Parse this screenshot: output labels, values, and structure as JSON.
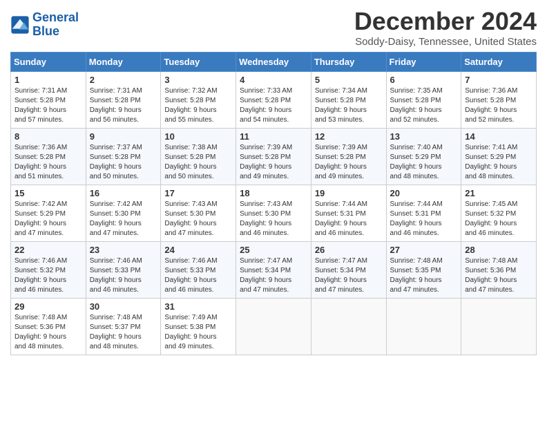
{
  "header": {
    "logo_line1": "General",
    "logo_line2": "Blue",
    "month_title": "December 2024",
    "location": "Soddy-Daisy, Tennessee, United States"
  },
  "weekdays": [
    "Sunday",
    "Monday",
    "Tuesday",
    "Wednesday",
    "Thursday",
    "Friday",
    "Saturday"
  ],
  "weeks": [
    [
      {
        "day": "1",
        "info": "Sunrise: 7:31 AM\nSunset: 5:28 PM\nDaylight: 9 hours\nand 57 minutes."
      },
      {
        "day": "2",
        "info": "Sunrise: 7:31 AM\nSunset: 5:28 PM\nDaylight: 9 hours\nand 56 minutes."
      },
      {
        "day": "3",
        "info": "Sunrise: 7:32 AM\nSunset: 5:28 PM\nDaylight: 9 hours\nand 55 minutes."
      },
      {
        "day": "4",
        "info": "Sunrise: 7:33 AM\nSunset: 5:28 PM\nDaylight: 9 hours\nand 54 minutes."
      },
      {
        "day": "5",
        "info": "Sunrise: 7:34 AM\nSunset: 5:28 PM\nDaylight: 9 hours\nand 53 minutes."
      },
      {
        "day": "6",
        "info": "Sunrise: 7:35 AM\nSunset: 5:28 PM\nDaylight: 9 hours\nand 52 minutes."
      },
      {
        "day": "7",
        "info": "Sunrise: 7:36 AM\nSunset: 5:28 PM\nDaylight: 9 hours\nand 52 minutes."
      }
    ],
    [
      {
        "day": "8",
        "info": "Sunrise: 7:36 AM\nSunset: 5:28 PM\nDaylight: 9 hours\nand 51 minutes."
      },
      {
        "day": "9",
        "info": "Sunrise: 7:37 AM\nSunset: 5:28 PM\nDaylight: 9 hours\nand 50 minutes."
      },
      {
        "day": "10",
        "info": "Sunrise: 7:38 AM\nSunset: 5:28 PM\nDaylight: 9 hours\nand 50 minutes."
      },
      {
        "day": "11",
        "info": "Sunrise: 7:39 AM\nSunset: 5:28 PM\nDaylight: 9 hours\nand 49 minutes."
      },
      {
        "day": "12",
        "info": "Sunrise: 7:39 AM\nSunset: 5:28 PM\nDaylight: 9 hours\nand 49 minutes."
      },
      {
        "day": "13",
        "info": "Sunrise: 7:40 AM\nSunset: 5:29 PM\nDaylight: 9 hours\nand 48 minutes."
      },
      {
        "day": "14",
        "info": "Sunrise: 7:41 AM\nSunset: 5:29 PM\nDaylight: 9 hours\nand 48 minutes."
      }
    ],
    [
      {
        "day": "15",
        "info": "Sunrise: 7:42 AM\nSunset: 5:29 PM\nDaylight: 9 hours\nand 47 minutes."
      },
      {
        "day": "16",
        "info": "Sunrise: 7:42 AM\nSunset: 5:30 PM\nDaylight: 9 hours\nand 47 minutes."
      },
      {
        "day": "17",
        "info": "Sunrise: 7:43 AM\nSunset: 5:30 PM\nDaylight: 9 hours\nand 47 minutes."
      },
      {
        "day": "18",
        "info": "Sunrise: 7:43 AM\nSunset: 5:30 PM\nDaylight: 9 hours\nand 46 minutes."
      },
      {
        "day": "19",
        "info": "Sunrise: 7:44 AM\nSunset: 5:31 PM\nDaylight: 9 hours\nand 46 minutes."
      },
      {
        "day": "20",
        "info": "Sunrise: 7:44 AM\nSunset: 5:31 PM\nDaylight: 9 hours\nand 46 minutes."
      },
      {
        "day": "21",
        "info": "Sunrise: 7:45 AM\nSunset: 5:32 PM\nDaylight: 9 hours\nand 46 minutes."
      }
    ],
    [
      {
        "day": "22",
        "info": "Sunrise: 7:46 AM\nSunset: 5:32 PM\nDaylight: 9 hours\nand 46 minutes."
      },
      {
        "day": "23",
        "info": "Sunrise: 7:46 AM\nSunset: 5:33 PM\nDaylight: 9 hours\nand 46 minutes."
      },
      {
        "day": "24",
        "info": "Sunrise: 7:46 AM\nSunset: 5:33 PM\nDaylight: 9 hours\nand 46 minutes."
      },
      {
        "day": "25",
        "info": "Sunrise: 7:47 AM\nSunset: 5:34 PM\nDaylight: 9 hours\nand 47 minutes."
      },
      {
        "day": "26",
        "info": "Sunrise: 7:47 AM\nSunset: 5:34 PM\nDaylight: 9 hours\nand 47 minutes."
      },
      {
        "day": "27",
        "info": "Sunrise: 7:48 AM\nSunset: 5:35 PM\nDaylight: 9 hours\nand 47 minutes."
      },
      {
        "day": "28",
        "info": "Sunrise: 7:48 AM\nSunset: 5:36 PM\nDaylight: 9 hours\nand 47 minutes."
      }
    ],
    [
      {
        "day": "29",
        "info": "Sunrise: 7:48 AM\nSunset: 5:36 PM\nDaylight: 9 hours\nand 48 minutes."
      },
      {
        "day": "30",
        "info": "Sunrise: 7:48 AM\nSunset: 5:37 PM\nDaylight: 9 hours\nand 48 minutes."
      },
      {
        "day": "31",
        "info": "Sunrise: 7:49 AM\nSunset: 5:38 PM\nDaylight: 9 hours\nand 49 minutes."
      },
      {
        "day": "",
        "info": ""
      },
      {
        "day": "",
        "info": ""
      },
      {
        "day": "",
        "info": ""
      },
      {
        "day": "",
        "info": ""
      }
    ]
  ]
}
